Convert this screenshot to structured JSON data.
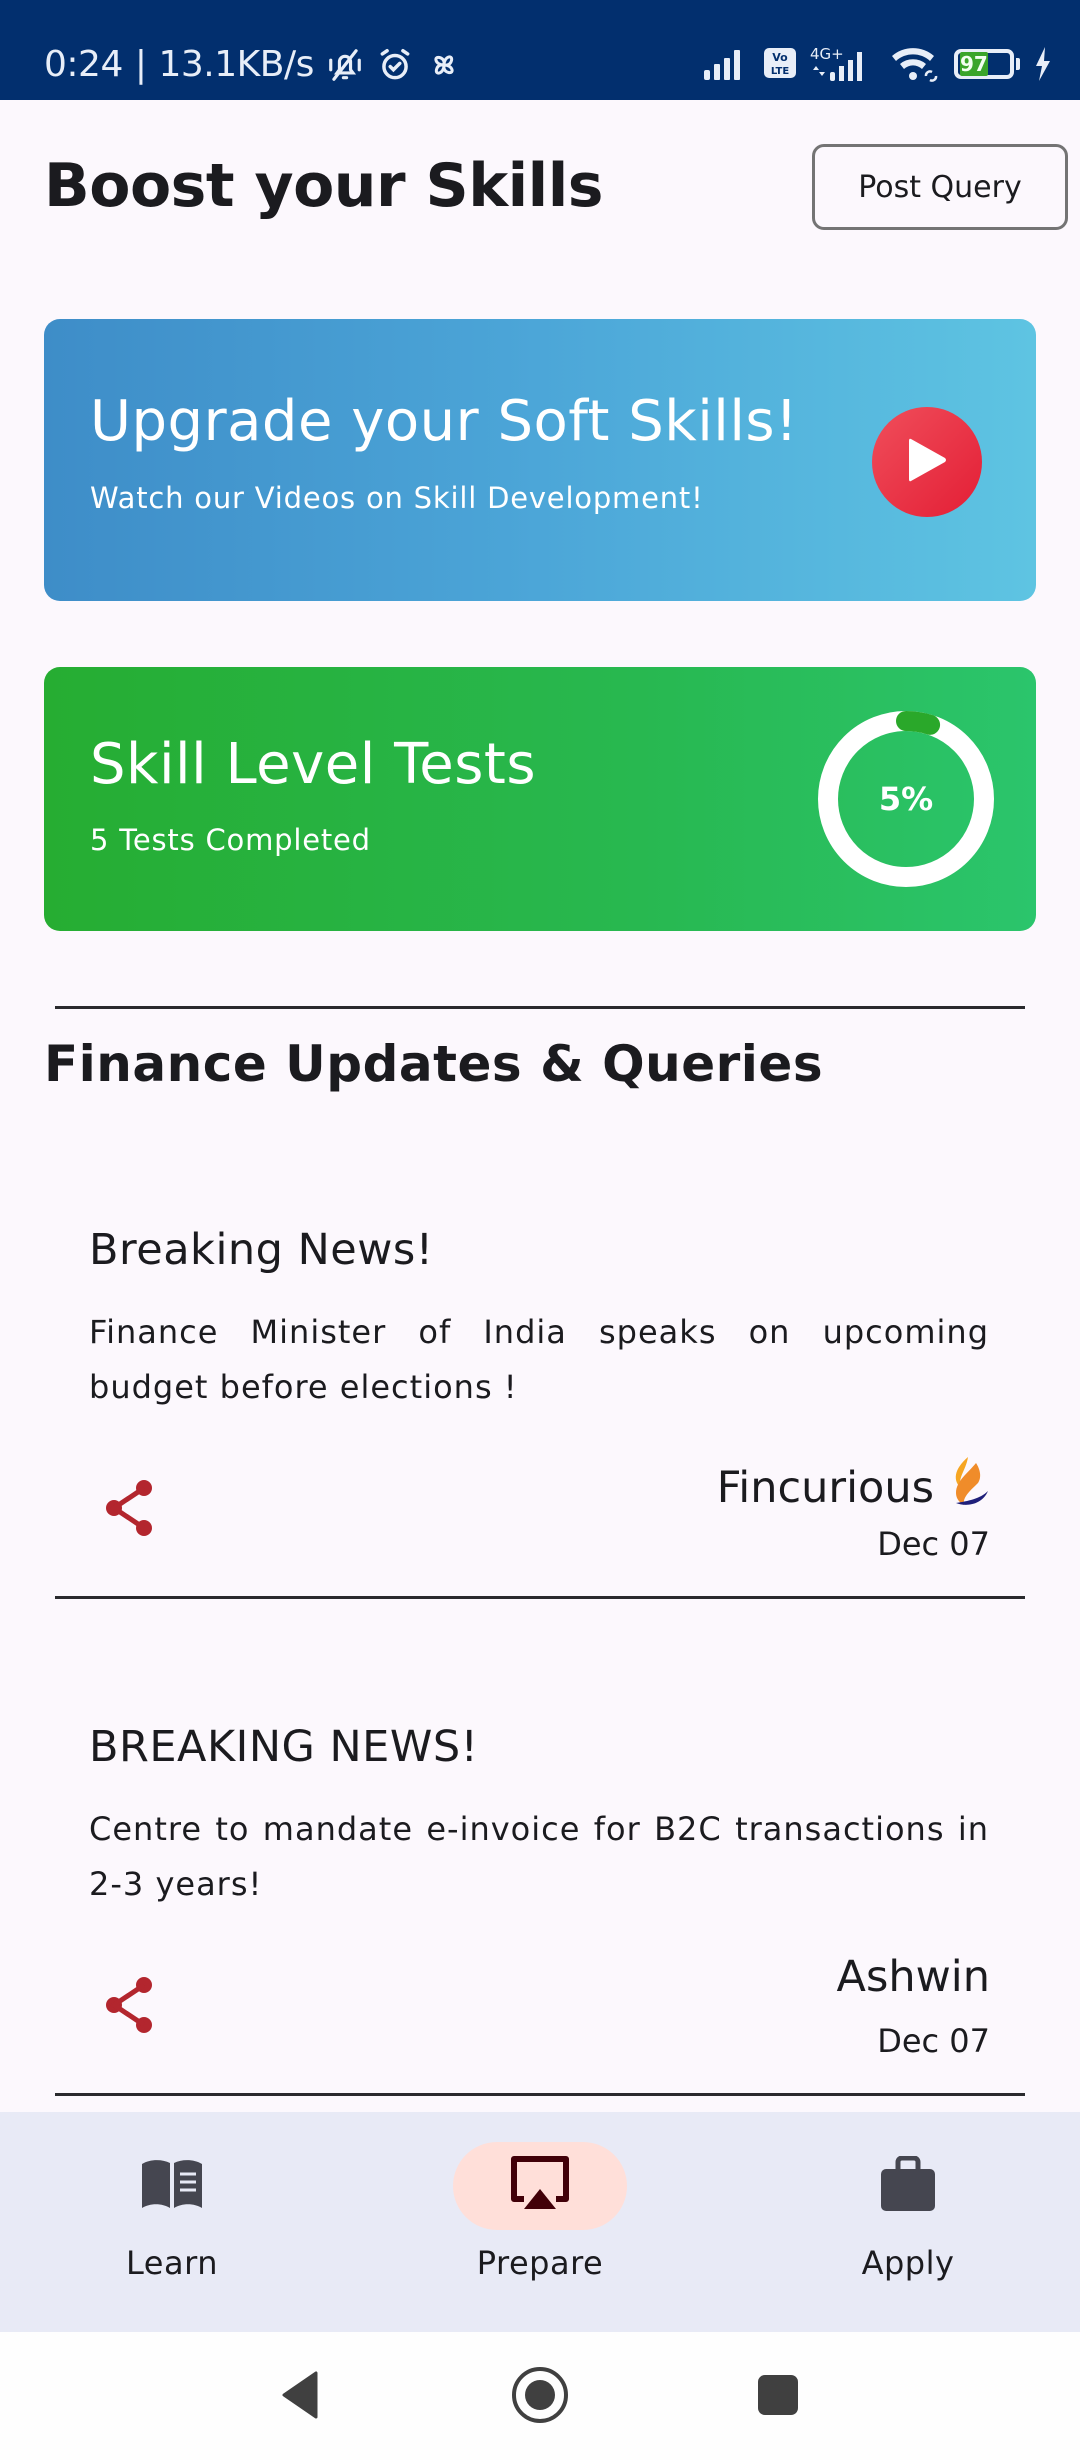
{
  "status_bar": {
    "time": "0:24",
    "separator": "|",
    "network_speed": "13.1KB/s",
    "left_icons": [
      "vibrate-silent-icon",
      "alarm-icon",
      "pinwheel-icon"
    ],
    "right_icons": [
      "signal-icon",
      "volte-icon",
      "4g-plus-signal-icon",
      "wifi-icon",
      "battery-icon",
      "charging-icon"
    ],
    "network_type": "4G+",
    "volte_label": "Vo LTE",
    "battery_percent": "97"
  },
  "header": {
    "title": "Boost your Skills",
    "post_query_label": "Post Query"
  },
  "soft_skills_card": {
    "title": "Upgrade your Soft Skills!",
    "subtitle": "Watch our Videos on Skill Development!",
    "icon": "play-icon",
    "colors": {
      "start": "#3e8dc8",
      "end": "#5ec4e2",
      "play": "#e8293f"
    }
  },
  "skill_tests_card": {
    "title": "Skill Level Tests",
    "subtitle": "5 Tests Completed",
    "progress_percent": 5,
    "progress_label": "5%",
    "colors": {
      "start": "#26ad32",
      "end": "#2bc56c",
      "track": "#ffffff",
      "fill": "#2aa82a"
    }
  },
  "section": {
    "title": "Finance Updates & Queries"
  },
  "news": [
    {
      "title": "Breaking News!",
      "body": "Finance Minister of India speaks on upcoming budget before elections !",
      "author": "Fincurious",
      "author_has_logo": true,
      "date": "Dec 07"
    },
    {
      "title": "BREAKING NEWS!",
      "body": "Centre to mandate e-invoice for B2C transactions in 2-3 years!",
      "author": "Ashwin",
      "author_has_logo": false,
      "date": "Dec 07"
    }
  ],
  "bottom_nav": {
    "items": [
      {
        "label": "Learn",
        "icon": "book-icon",
        "active": false
      },
      {
        "label": "Prepare",
        "icon": "airplay-icon",
        "active": true
      },
      {
        "label": "Apply",
        "icon": "briefcase-icon",
        "active": false
      }
    ],
    "active_color": "#ffdfd9"
  },
  "system_nav": {
    "buttons": [
      "back-icon",
      "home-icon",
      "recents-icon"
    ]
  }
}
